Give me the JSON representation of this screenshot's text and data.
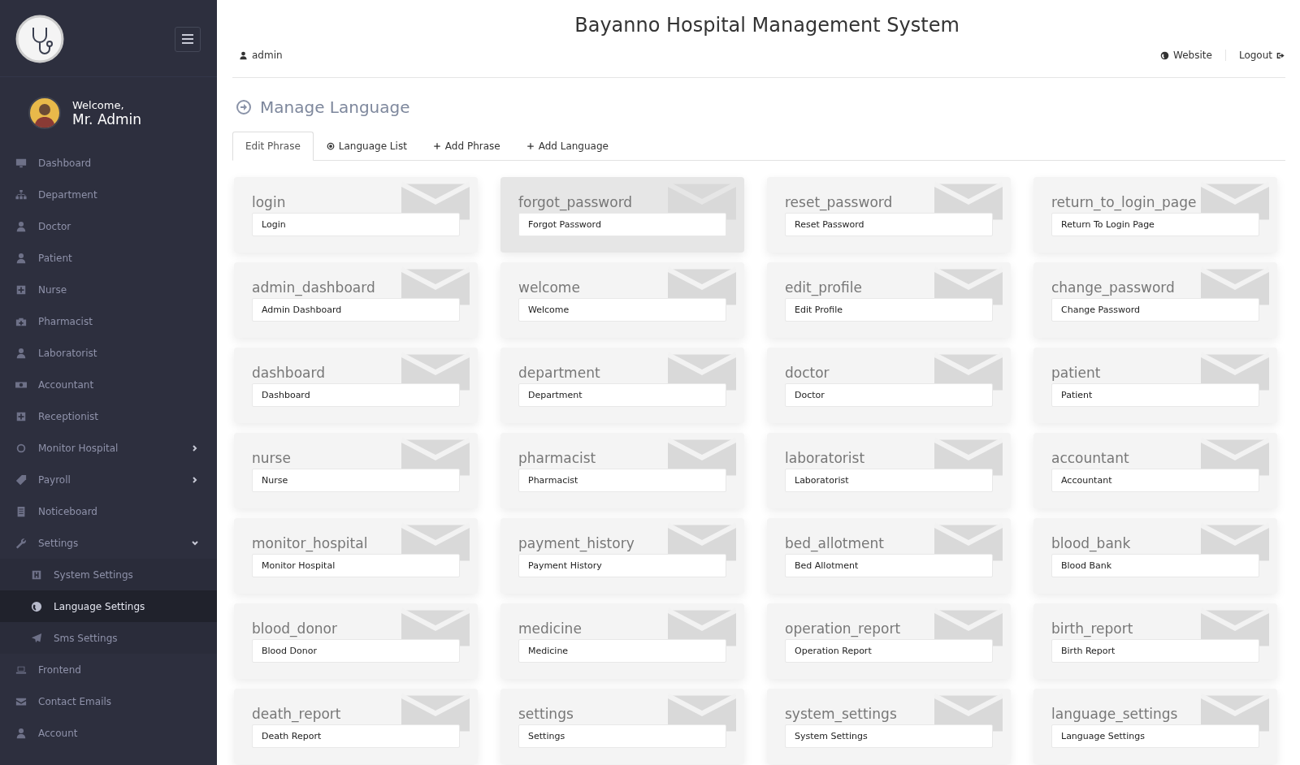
{
  "header": {
    "title": "Bayanno Hospital Management System",
    "user": "admin",
    "links": [
      {
        "label": "Website",
        "kind": "globe"
      },
      {
        "label": "Logout",
        "kind": "logout"
      }
    ]
  },
  "sidebar": {
    "welcome": "Welcome,",
    "name": "Mr. Admin",
    "items": [
      {
        "label": "Dashboard",
        "kind": "monitor",
        "selected": false
      },
      {
        "label": "Department",
        "kind": "sitemap",
        "selected": false
      },
      {
        "label": "Doctor",
        "kind": "user",
        "selected": false
      },
      {
        "label": "Patient",
        "kind": "user",
        "selected": false
      },
      {
        "label": "Nurse",
        "kind": "plus-square",
        "selected": false
      },
      {
        "label": "Pharmacist",
        "kind": "briefcase",
        "selected": false
      },
      {
        "label": "Laboratorist",
        "kind": "user",
        "selected": false
      },
      {
        "label": "Accountant",
        "kind": "money",
        "selected": false
      },
      {
        "label": "Receptionist",
        "kind": "plus-square",
        "selected": false
      },
      {
        "label": "Monitor Hospital",
        "kind": "gear",
        "selected": false,
        "expanded": false
      },
      {
        "label": "Payroll",
        "kind": "tag",
        "selected": false,
        "expanded": false
      },
      {
        "label": "Noticeboard",
        "kind": "file",
        "selected": false
      },
      {
        "label": "Settings",
        "kind": "wrench",
        "selected": false,
        "expanded": true,
        "children": [
          {
            "label": "System Settings",
            "kind": "hdd",
            "selected": false
          },
          {
            "label": "Language Settings",
            "kind": "globe",
            "selected": true
          },
          {
            "label": "Sms Settings",
            "kind": "plane",
            "selected": false
          }
        ]
      },
      {
        "label": "Frontend",
        "kind": "laptop",
        "selected": false
      },
      {
        "label": "Contact Emails",
        "kind": "envelope",
        "selected": false
      },
      {
        "label": "Account",
        "kind": "user",
        "selected": false
      }
    ]
  },
  "page_title": "Manage Language",
  "tabs": [
    {
      "label": "Edit Phrase",
      "kind": "text",
      "selected": true
    },
    {
      "label": "Language List",
      "kind": "bullseye",
      "selected": false
    },
    {
      "label": "Add Phrase",
      "kind": "plus",
      "selected": false
    },
    {
      "label": "Add Language",
      "kind": "plus",
      "selected": false
    }
  ],
  "phrases": [
    {
      "key": "login",
      "value": "Login",
      "highlighted": false
    },
    {
      "key": "forgot_password",
      "value": "Forgot Password",
      "highlighted": true
    },
    {
      "key": "reset_password",
      "value": "Reset Password",
      "highlighted": false
    },
    {
      "key": "return_to_login_page",
      "value": "Return To Login Page",
      "highlighted": false
    },
    {
      "key": "admin_dashboard",
      "value": "Admin Dashboard",
      "highlighted": false
    },
    {
      "key": "welcome",
      "value": "Welcome",
      "highlighted": false
    },
    {
      "key": "edit_profile",
      "value": "Edit Profile",
      "highlighted": false
    },
    {
      "key": "change_password",
      "value": "Change Password",
      "highlighted": false
    },
    {
      "key": "dashboard",
      "value": "Dashboard",
      "highlighted": false
    },
    {
      "key": "department",
      "value": "Department",
      "highlighted": false
    },
    {
      "key": "doctor",
      "value": "Doctor",
      "highlighted": false
    },
    {
      "key": "patient",
      "value": "Patient",
      "highlighted": false
    },
    {
      "key": "nurse",
      "value": "Nurse",
      "highlighted": false
    },
    {
      "key": "pharmacist",
      "value": "Pharmacist",
      "highlighted": false
    },
    {
      "key": "laboratorist",
      "value": "Laboratorist",
      "highlighted": false
    },
    {
      "key": "accountant",
      "value": "Accountant",
      "highlighted": false
    },
    {
      "key": "monitor_hospital",
      "value": "Monitor Hospital",
      "highlighted": false
    },
    {
      "key": "payment_history",
      "value": "Payment History",
      "highlighted": false
    },
    {
      "key": "bed_allotment",
      "value": "Bed Allotment",
      "highlighted": false
    },
    {
      "key": "blood_bank",
      "value": "Blood Bank",
      "highlighted": false
    },
    {
      "key": "blood_donor",
      "value": "Blood Donor",
      "highlighted": false
    },
    {
      "key": "medicine",
      "value": "Medicine",
      "highlighted": false
    },
    {
      "key": "operation_report",
      "value": "Operation Report",
      "highlighted": false
    },
    {
      "key": "birth_report",
      "value": "Birth Report",
      "highlighted": false
    },
    {
      "key": "death_report",
      "value": "Death Report",
      "highlighted": false
    },
    {
      "key": "settings",
      "value": "Settings",
      "highlighted": false
    },
    {
      "key": "system_settings",
      "value": "System Settings",
      "highlighted": false
    },
    {
      "key": "language_settings",
      "value": "Language Settings",
      "highlighted": false
    }
  ]
}
